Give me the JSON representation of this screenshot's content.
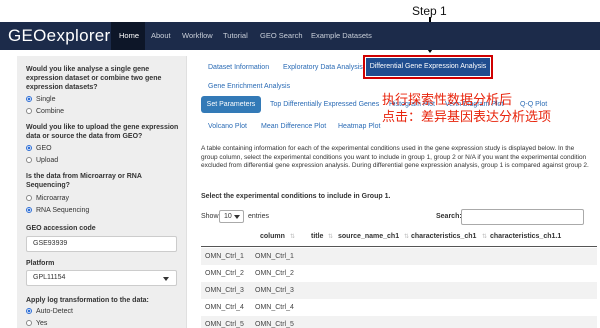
{
  "annotation": {
    "step": "Step 1",
    "chinese_line1": "执行探索性数据分析后",
    "chinese_line2": "点击：差异基因表达分析选项"
  },
  "navbar": {
    "brand": "GEOexplorer",
    "items": [
      "Home",
      "About",
      "Workflow",
      "Tutorial",
      "GEO Search",
      "Example Datasets"
    ],
    "active": "Home"
  },
  "sidebar": {
    "q1": "Would you like analyse a single gene expression dataset or combine two gene expression datasets?",
    "q1_options": [
      "Single",
      "Combine"
    ],
    "q2": "Would you like to upload the gene expression data or source the data from GEO?",
    "q2_options": [
      "GEO",
      "Upload"
    ],
    "q3": "Is the data from Microarray or RNA Sequencing?",
    "q3_options": [
      "Microarray",
      "RNA Sequencing"
    ],
    "accession_label": "GEO accession code",
    "accession_value": "GSE93939",
    "platform_label": "Platform",
    "platform_value": "GPL11154",
    "log_label": "Apply log transformation to the data:",
    "log_options": [
      "Auto-Detect",
      "Yes"
    ]
  },
  "main": {
    "tabs_row1": [
      "Dataset Information",
      "Exploratory Data Analysis",
      "Differential Gene Expression Analysis"
    ],
    "tabs_row2": [
      "Gene Enrichment Analysis"
    ],
    "subtabs_row1": [
      "Set Parameters",
      "Top Differentially Expressed Genes",
      "Histogram Plot",
      "Venn Diagram Plot",
      "Q-Q Plot"
    ],
    "subtabs_row2": [
      "Volcano Plot",
      "Mean Difference Plot",
      "Heatmap Plot"
    ],
    "description": "A table containing information for each of the experimental conditions used in the gene expression study is displayed below. In the group column, select the experimental conditions you want to include in group 1, group 2 or N/A if you want the experimental condition excluded from differential gene expression analysis. During differential gene expression analysis, group 1 is compared against group 2.",
    "select_title": "Select the experimental conditions to include in Group 1.",
    "show_label": "Show",
    "show_value": "10",
    "entries_label": "entries",
    "search_label": "Search:"
  },
  "table": {
    "headers": [
      "column",
      "title",
      "source_name_ch1",
      "characteristics_ch1",
      "characteristics_ch1.1"
    ],
    "rows": [
      [
        "OMN_Ctrl_1",
        "OMN_Ctrl_1"
      ],
      [
        "OMN_Ctrl_2",
        "OMN_Ctrl_2"
      ],
      [
        "OMN_Ctrl_3",
        "OMN_Ctrl_3"
      ],
      [
        "OMN_Ctrl_4",
        "OMN_Ctrl_4"
      ],
      [
        "OMN_Ctrl_5",
        "OMN_Ctrl_5"
      ]
    ]
  },
  "colors": {
    "navbar": "#1c2b4a",
    "accent": "#337ab7",
    "highlight_border": "#d00000",
    "annotation_text": "#e8240c"
  }
}
